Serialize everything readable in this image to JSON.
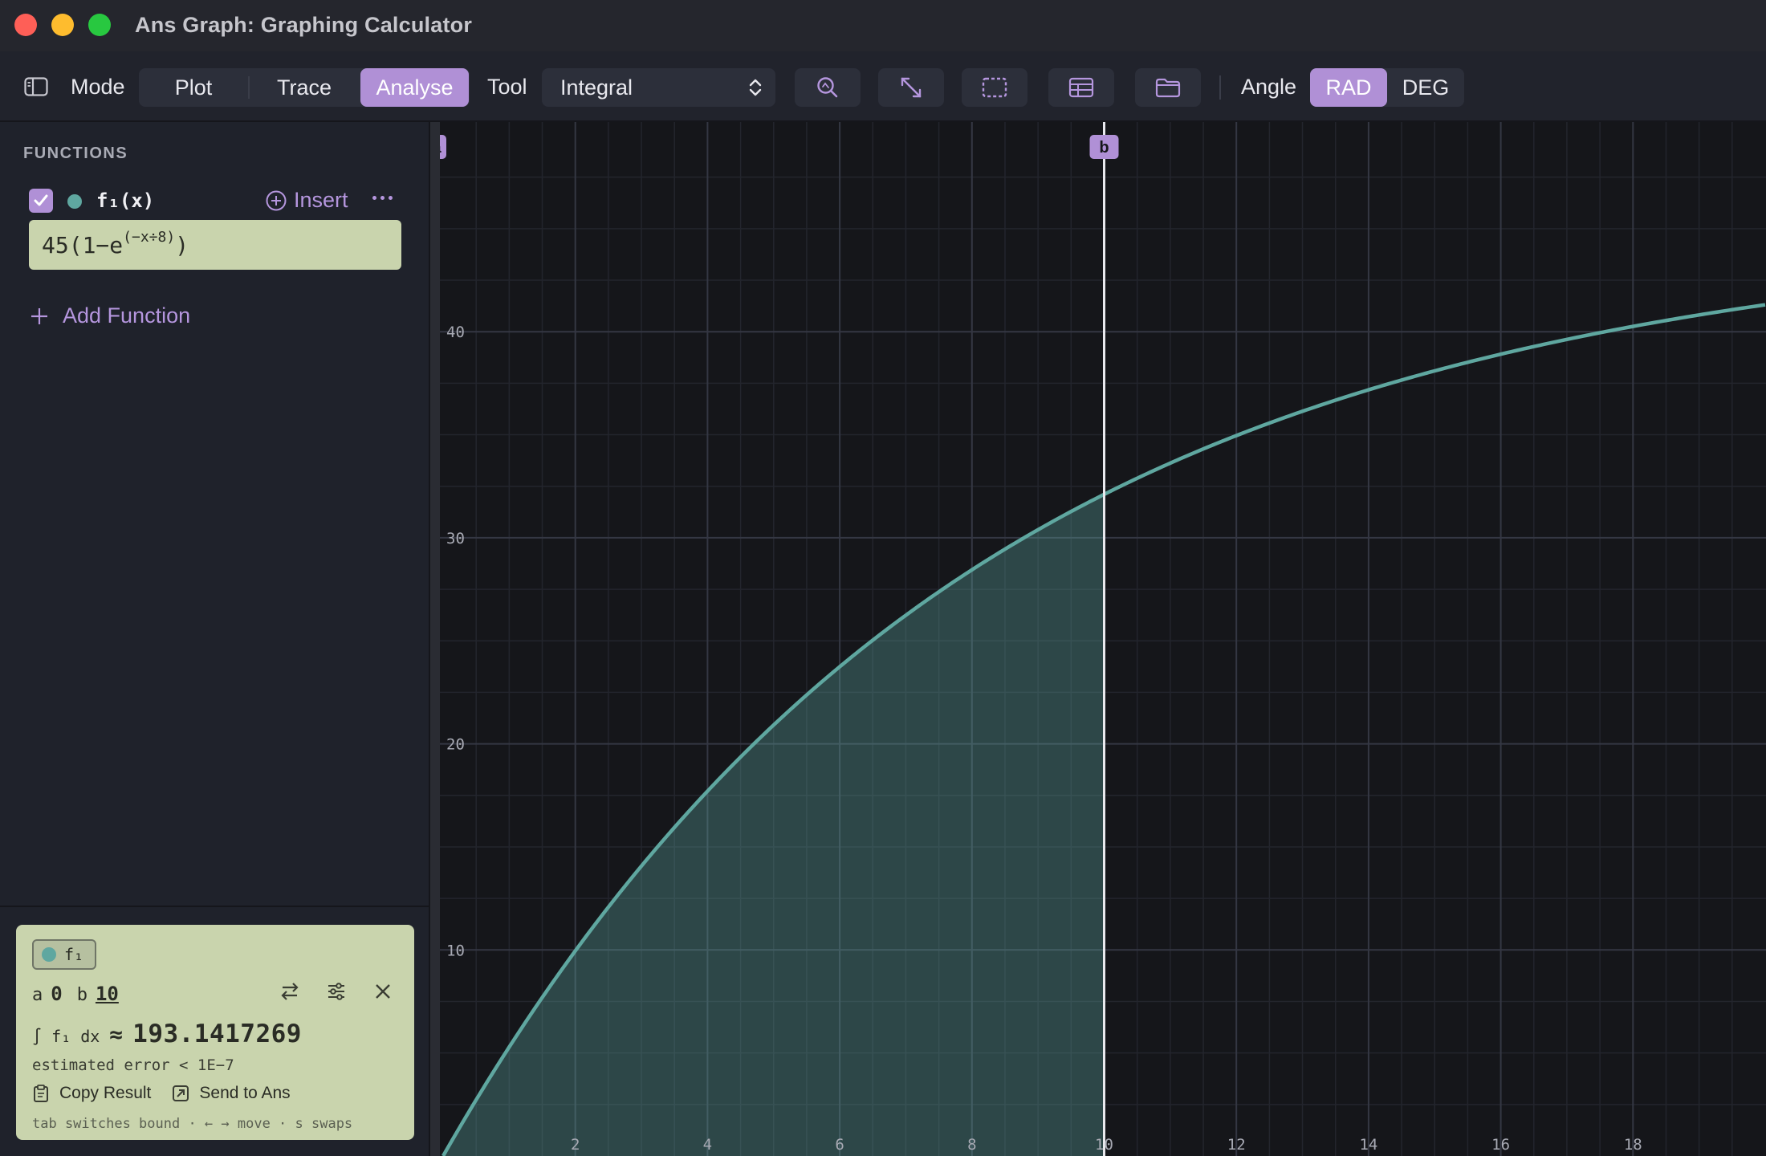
{
  "window": {
    "title": "Ans Graph: Graphing Calculator"
  },
  "toolbar": {
    "mode_label": "Mode",
    "modes": [
      "Plot",
      "Trace",
      "Analyse"
    ],
    "active_mode": "Analyse",
    "tool_label": "Tool",
    "tool_value": "Integral",
    "angle_label": "Angle",
    "angle_units": [
      "RAD",
      "DEG"
    ],
    "active_angle": "RAD",
    "icons": [
      "sidebar-toggle-icon",
      "zoom-icon",
      "fit-view-icon",
      "selection-icon",
      "table-icon",
      "folder-icon"
    ]
  },
  "sidebar": {
    "section_title": "FUNCTIONS",
    "functions": [
      {
        "name": "f₁(x)",
        "enabled": true,
        "color": "#5fa7a0",
        "expr_main": "45(1−e",
        "expr_exp": "(−x÷8)",
        "expr_close": ")"
      }
    ],
    "insert_label": "Insert",
    "add_function_label": "Add Function"
  },
  "result": {
    "function_chip": "f₁",
    "a_label": "a",
    "a_value": "0",
    "b_label": "b",
    "b_value": "10",
    "integral_prefix": "∫ f₁ dx",
    "approx_symbol": "≈",
    "value": "193.1417269",
    "error_text": "estimated error < 1E−7",
    "copy_label": "Copy Result",
    "send_label": "Send to Ans",
    "hint": "tab switches bound · ← → move · s swaps"
  },
  "graph": {
    "accent": "#b090d6",
    "curve_color": "#5fa7a0",
    "marker_a": "a",
    "marker_b": "b"
  },
  "chart_data": {
    "type": "area",
    "function": "45*(1-exp(-x/8))",
    "xlim": [
      0,
      20
    ],
    "ylim": [
      0,
      49
    ],
    "x_ticks": [
      2,
      4,
      6,
      8,
      10,
      12,
      14,
      16,
      18
    ],
    "y_ticks": [
      10,
      20,
      30,
      40
    ],
    "shaded_interval": [
      0,
      10
    ],
    "bound_a": 0,
    "bound_b": 10,
    "grid": true
  }
}
